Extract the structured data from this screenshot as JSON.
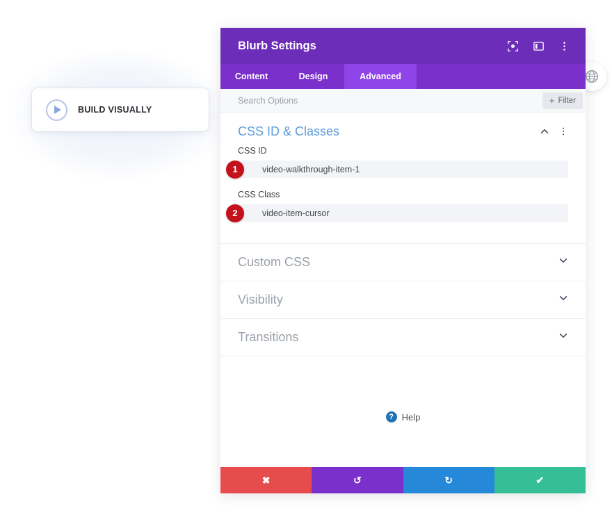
{
  "page": {
    "background_color": "#ffffff"
  },
  "build_visually": {
    "label": "BUILD VISUALLY",
    "play_icon": "play-circle-icon"
  },
  "floating_button": {
    "icon": "globe-icon"
  },
  "panel": {
    "title": "Blurb Settings",
    "header_color": "#6c2eb9",
    "tabs_color": "#7b30cc",
    "active_tab_color": "#8e44e8",
    "header_icons": [
      {
        "name": "focus-target-icon"
      },
      {
        "name": "layout-panel-icon"
      },
      {
        "name": "kebab-menu-icon"
      }
    ],
    "tabs": [
      {
        "label": "Content",
        "active": false
      },
      {
        "label": "Design",
        "active": false
      },
      {
        "label": "Advanced",
        "active": true
      }
    ],
    "search": {
      "placeholder": "Search Options",
      "value": ""
    },
    "filter_button": {
      "label": "Filter",
      "plus": "+"
    },
    "sections": [
      {
        "title": "CSS ID & Classes",
        "state": "expanded",
        "title_color": "#5b9dd9",
        "toggle_icon": "chevron-up-icon",
        "menu_icon": "kebab-menu-icon",
        "fields": [
          {
            "label": "CSS ID",
            "value": "video-walkthrough-item-1",
            "placeholder": "",
            "badge": "1"
          },
          {
            "label": "CSS Class",
            "value": "video-item-cursor",
            "placeholder": "",
            "badge": "2"
          }
        ]
      },
      {
        "title": "Custom CSS",
        "state": "collapsed",
        "title_color": "#9aa0a8",
        "toggle_icon": "chevron-down-icon"
      },
      {
        "title": "Visibility",
        "state": "collapsed",
        "title_color": "#9aa0a8",
        "toggle_icon": "chevron-down-icon"
      },
      {
        "title": "Transitions",
        "state": "collapsed",
        "title_color": "#9aa0a8",
        "toggle_icon": "chevron-down-icon"
      }
    ],
    "help": {
      "label": "Help",
      "icon": "question-mark-icon"
    },
    "actions": [
      {
        "name": "cancel",
        "glyph": "✖",
        "color": "#e74c4c"
      },
      {
        "name": "undo",
        "glyph": "↺",
        "color": "#7b30cc"
      },
      {
        "name": "redo",
        "glyph": "↻",
        "color": "#2688d8"
      },
      {
        "name": "save",
        "glyph": "✔",
        "color": "#36bf96"
      }
    ]
  },
  "badges": {
    "color": "#c4111b"
  }
}
